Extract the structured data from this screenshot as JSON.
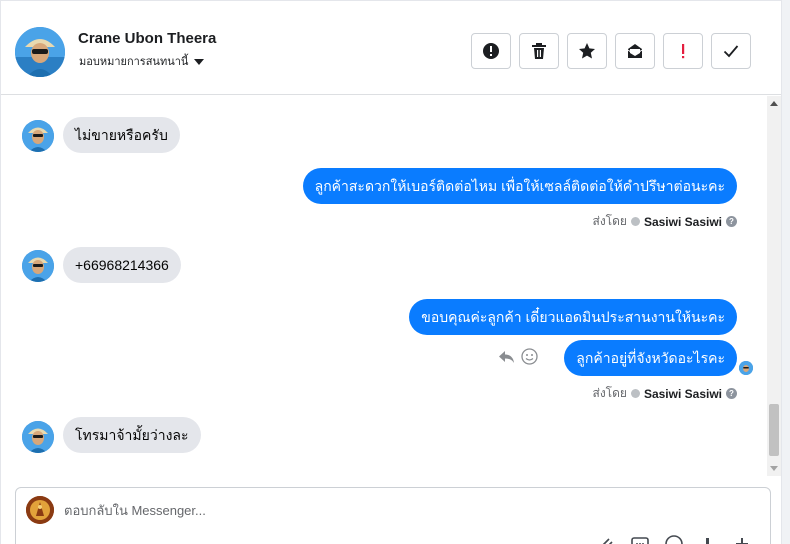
{
  "contact": {
    "name": "Crane Ubon Theera",
    "assign_label": "มอบหมายการสนทนานี้"
  },
  "header_actions": [
    {
      "icon": "alert-circle-icon"
    },
    {
      "icon": "trash-icon"
    },
    {
      "icon": "star-icon"
    },
    {
      "icon": "envelope-open-icon"
    },
    {
      "icon": "exclamation-icon"
    },
    {
      "icon": "checkmark-icon"
    }
  ],
  "messages": [
    {
      "dir": "in",
      "text": "ไม่ขายหรือครับ"
    },
    {
      "dir": "out",
      "text": "ลูกค้าสะดวกให้เบอร์ติดต่อไหม เพื่อให้เซลล์ติดต่อให้คำปรึษาต่อนะคะ"
    },
    {
      "dir": "meta",
      "sent_prefix": "ส่งโดย",
      "agent": "Sasiwi Sasiwi"
    },
    {
      "dir": "in",
      "text": "+66968214366"
    },
    {
      "dir": "out",
      "text": "ขอบคุณค่ะลูกค้า เดี๋ยวแอดมินประสานงานให้นะคะ"
    },
    {
      "dir": "out",
      "text": "ลูกค้าอยู่ที่จังหวัดอะไรคะ"
    },
    {
      "dir": "meta",
      "sent_prefix": "ส่งโดย",
      "agent": "Sasiwi Sasiwi"
    },
    {
      "dir": "in",
      "text": "โทรมาจ้ามั้ยว่างละ"
    }
  ],
  "composer": {
    "placeholder": "ตอบกลับใน Messenger..."
  },
  "colors": {
    "outgoing_bubble": "#0a7cff",
    "incoming_bubble": "#e4e6eb"
  }
}
